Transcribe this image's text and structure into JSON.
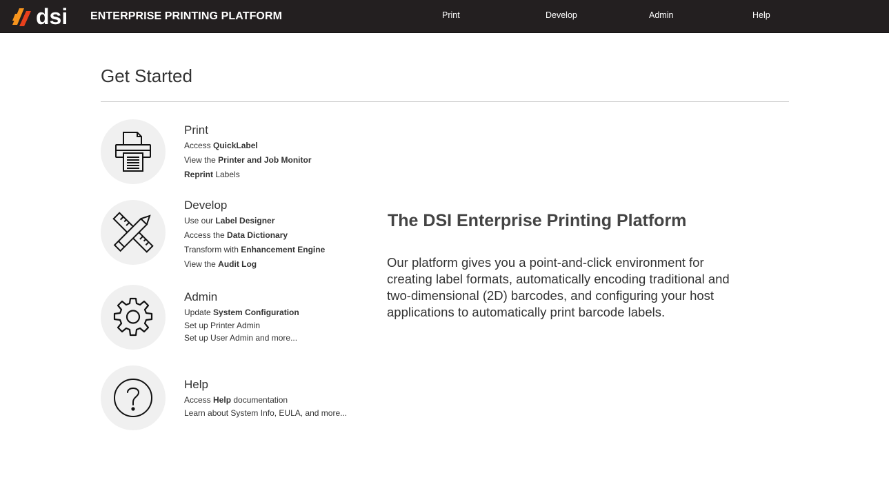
{
  "header": {
    "logo_text": "dsi",
    "brand_title": "ENTERPRISE PRINTING PLATFORM",
    "nav": {
      "print": "Print",
      "develop": "Develop",
      "admin": "Admin",
      "help": "Help"
    }
  },
  "main": {
    "title": "Get Started",
    "sections": {
      "print": {
        "icon": "printer-icon",
        "title": "Print",
        "lines": [
          {
            "pre": "Access ",
            "bold": "QuickLabel",
            "post": ""
          },
          {
            "pre": "View the ",
            "bold": "Printer and Job Monitor",
            "post": ""
          },
          {
            "pre": "",
            "bold": "Reprint",
            "post": " Labels"
          }
        ]
      },
      "develop": {
        "icon": "pencil-ruler-icon",
        "title": "Develop",
        "lines": [
          {
            "pre": "Use our ",
            "bold": "Label Designer",
            "post": ""
          },
          {
            "pre": "Access the ",
            "bold": "Data Dictionary",
            "post": ""
          },
          {
            "pre": "Transform with ",
            "bold": "Enhancement Engine",
            "post": ""
          },
          {
            "pre": "View the ",
            "bold": "Audit Log",
            "post": ""
          }
        ]
      },
      "admin": {
        "icon": "gear-icon",
        "title": "Admin",
        "lines": [
          {
            "pre": "Update ",
            "bold": "System Configuration",
            "post": ""
          },
          {
            "pre": "Set up Printer Admin",
            "bold": "",
            "post": ""
          },
          {
            "pre": "Set up User Admin and more...",
            "bold": "",
            "post": ""
          }
        ]
      },
      "help": {
        "icon": "question-icon",
        "title": "Help",
        "lines": [
          {
            "pre": "Access ",
            "bold": "Help",
            "post": " documentation"
          },
          {
            "pre": "Learn about System Info, EULA, and more...",
            "bold": "",
            "post": ""
          }
        ]
      }
    },
    "intro": {
      "title": "The DSI Enterprise Printing Platform",
      "body": "Our platform gives you a point-and-click environment for creating label formats, automatically encoding traditional and two-dimensional (2D) barcodes, and configuring your host applications to automatically print barcode labels."
    }
  },
  "colors": {
    "header_bg": "#231f20",
    "logo_orange": "#f7941d",
    "logo_red": "#e8401c",
    "icon_circle_bg": "#f0f0f0"
  }
}
